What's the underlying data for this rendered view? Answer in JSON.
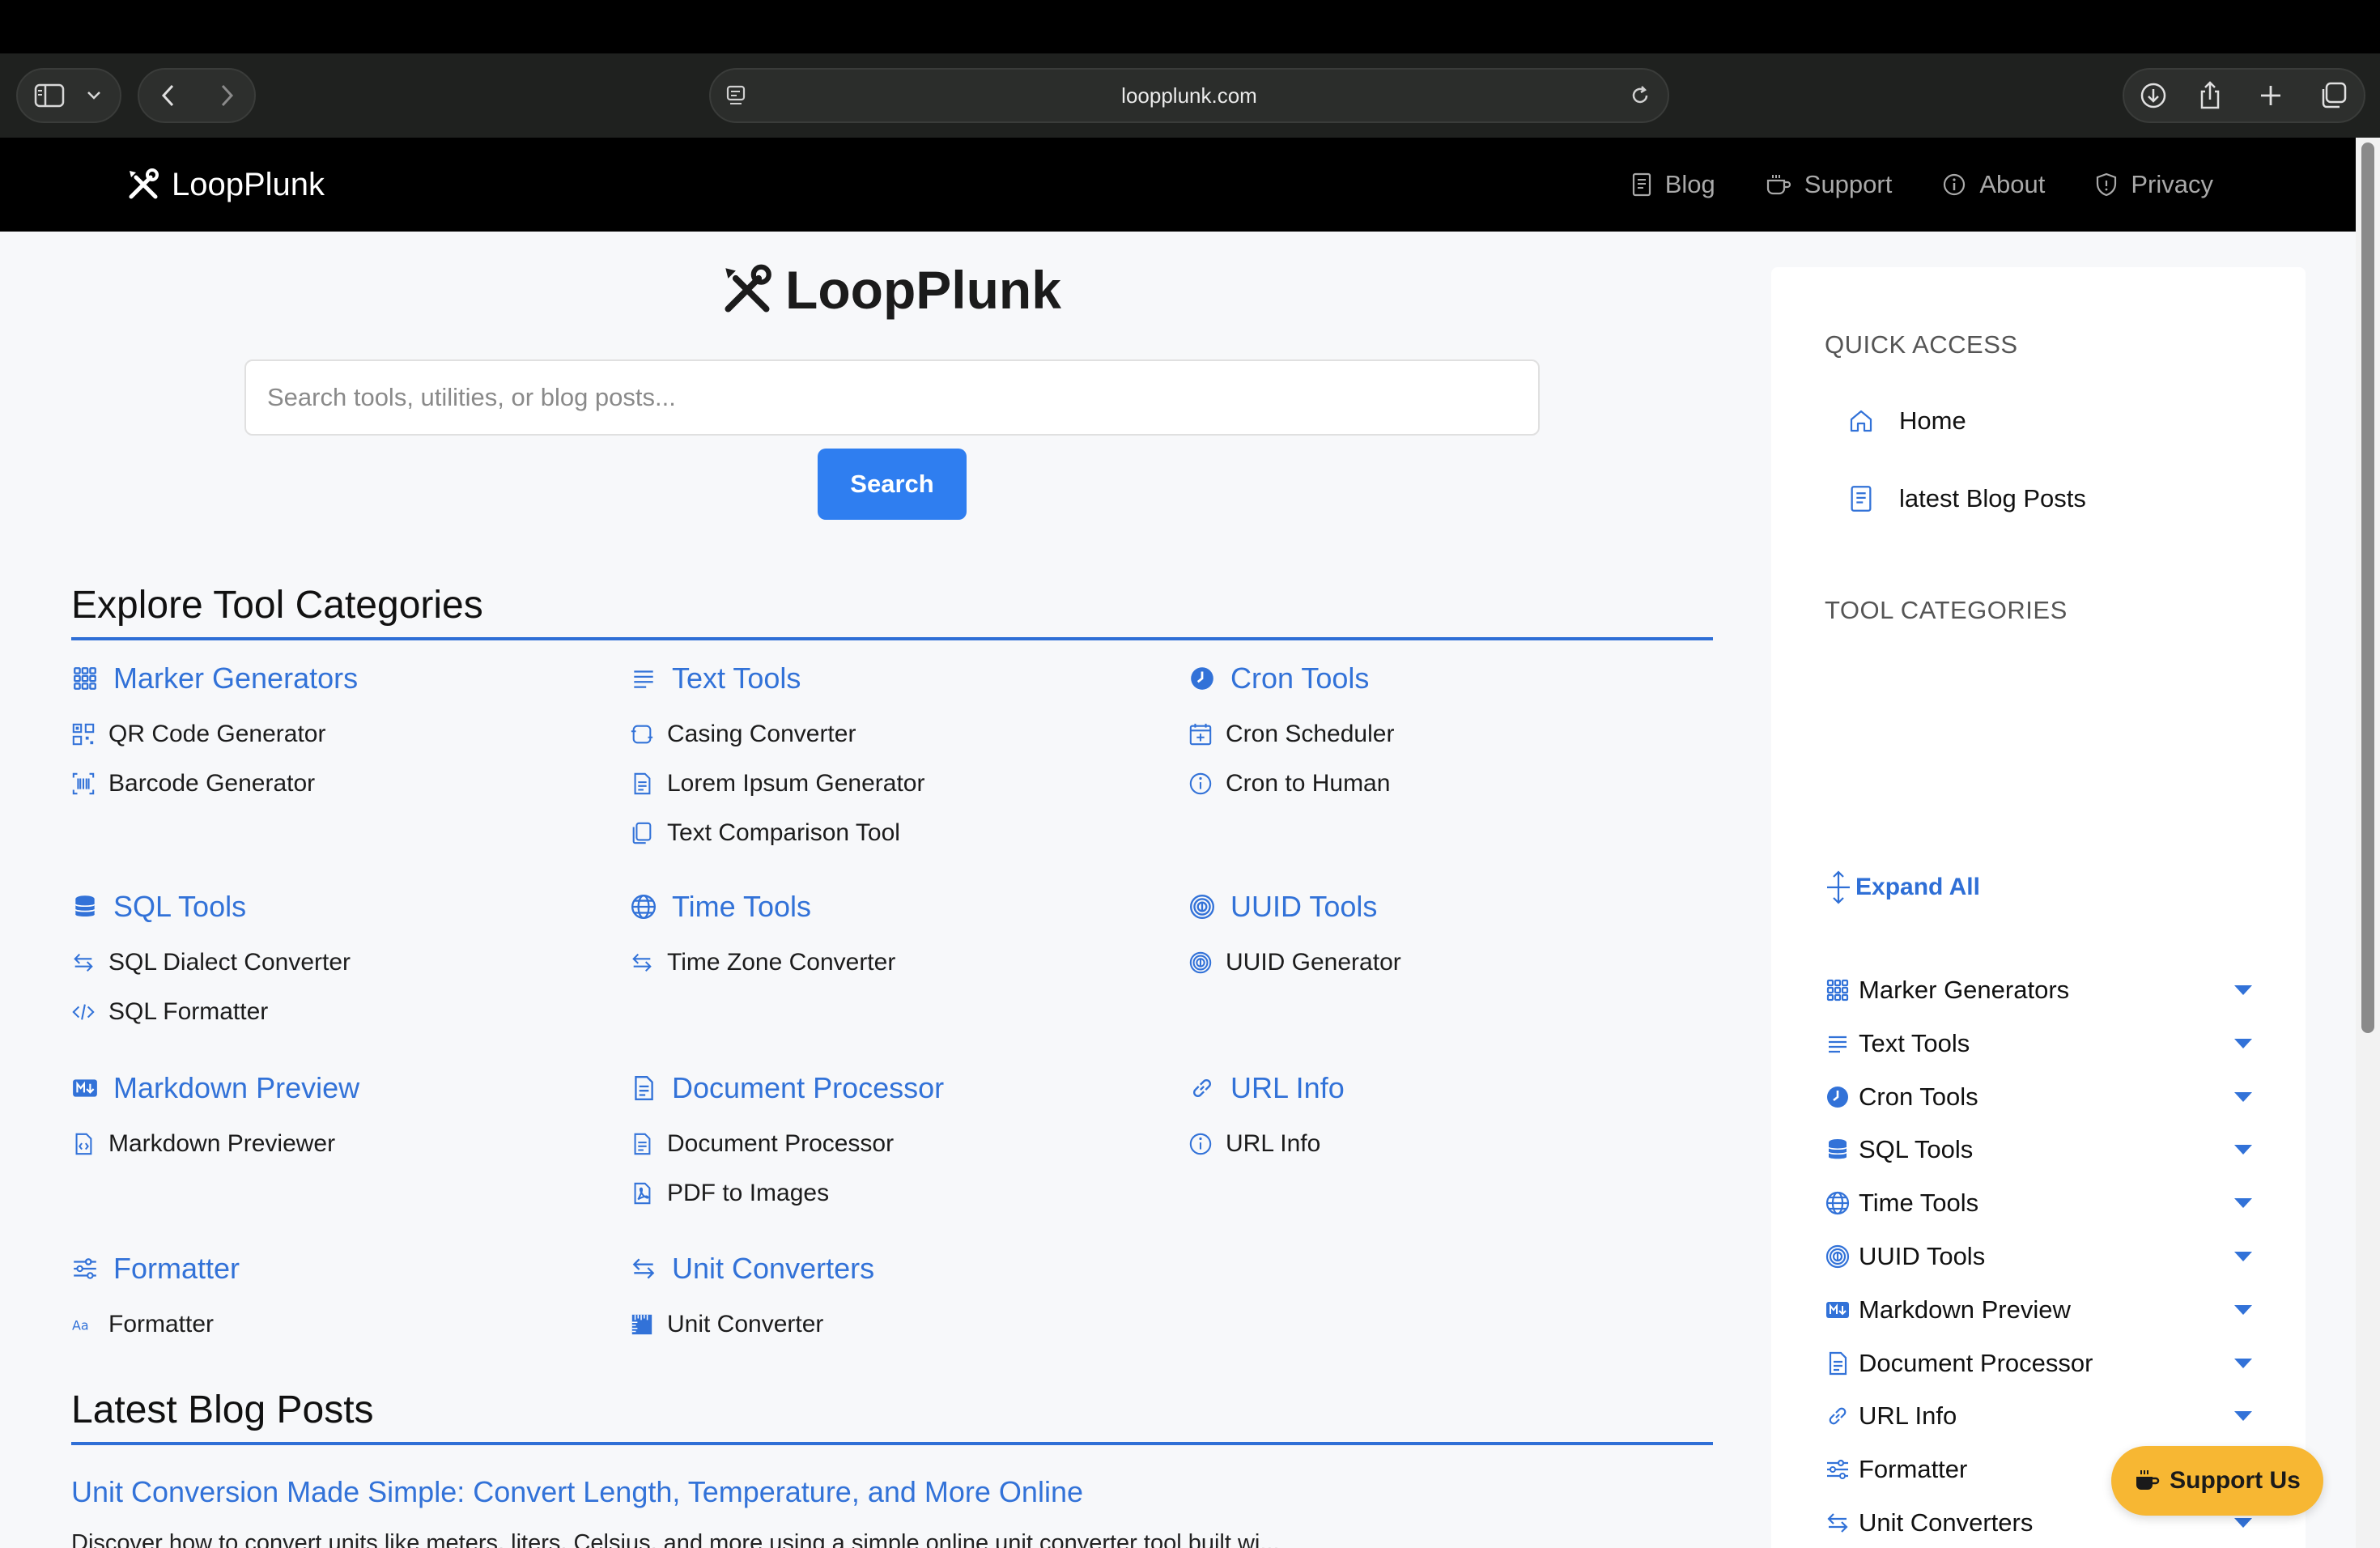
{
  "browser": {
    "url": "loopplunk.com"
  },
  "site": {
    "brand": "LoopPlunk",
    "nav": [
      {
        "label": "Blog",
        "icon": "blog-icon"
      },
      {
        "label": "Support",
        "icon": "coffee-icon"
      },
      {
        "label": "About",
        "icon": "info-icon"
      },
      {
        "label": "Privacy",
        "icon": "shield-icon"
      }
    ]
  },
  "hero": {
    "title": "LoopPlunk",
    "search_placeholder": "Search tools, utilities, or blog posts...",
    "search_button": "Search"
  },
  "explore": {
    "title": "Explore Tool Categories",
    "categories": [
      {
        "name": "Marker Generators",
        "icon": "grid-icon",
        "items": [
          {
            "label": "QR Code Generator",
            "icon": "qr-icon"
          },
          {
            "label": "Barcode Generator",
            "icon": "barcode-icon"
          }
        ]
      },
      {
        "name": "Text Tools",
        "icon": "text-lines-icon",
        "items": [
          {
            "label": "Casing Converter",
            "icon": "casing-icon"
          },
          {
            "label": "Lorem Ipsum Generator",
            "icon": "document-icon"
          },
          {
            "label": "Text Comparison Tool",
            "icon": "copy-icon"
          }
        ]
      },
      {
        "name": "Cron Tools",
        "icon": "clock-icon",
        "items": [
          {
            "label": "Cron Scheduler",
            "icon": "calendar-icon"
          },
          {
            "label": "Cron to Human",
            "icon": "info-icon"
          }
        ]
      },
      {
        "name": "SQL Tools",
        "icon": "database-icon",
        "items": [
          {
            "label": "SQL Dialect Converter",
            "icon": "arrows-icon"
          },
          {
            "label": "SQL Formatter",
            "icon": "code-icon"
          }
        ]
      },
      {
        "name": "Time Tools",
        "icon": "globe-icon",
        "items": [
          {
            "label": "Time Zone Converter",
            "icon": "arrows-icon"
          }
        ]
      },
      {
        "name": "UUID Tools",
        "icon": "fingerprint-icon",
        "items": [
          {
            "label": "UUID Generator",
            "icon": "fingerprint-icon"
          }
        ]
      },
      {
        "name": "Markdown Preview",
        "icon": "markdown-icon",
        "items": [
          {
            "label": "Markdown Previewer",
            "icon": "file-code-icon"
          }
        ]
      },
      {
        "name": "Document Processor",
        "icon": "document-icon",
        "items": [
          {
            "label": "Document Processor",
            "icon": "document-icon"
          },
          {
            "label": "PDF to Images",
            "icon": "pdf-icon"
          }
        ]
      },
      {
        "name": "URL Info",
        "icon": "link-icon",
        "items": [
          {
            "label": "URL Info",
            "icon": "info-icon"
          }
        ]
      },
      {
        "name": "Formatter",
        "icon": "sliders-icon",
        "items": [
          {
            "label": "Formatter",
            "icon": "font-icon"
          }
        ]
      },
      {
        "name": "Unit Converters",
        "icon": "arrows-icon",
        "items": [
          {
            "label": "Unit Converter",
            "icon": "ruler-icon"
          }
        ]
      }
    ]
  },
  "blog": {
    "title": "Latest Blog Posts",
    "post_title": "Unit Conversion Made Simple: Convert Length, Temperature, and More Online",
    "post_excerpt": "Discover how to convert units like meters, liters, Celsius, and more using a simple online unit converter tool built wi..."
  },
  "sidebar": {
    "quick_heading": "QUICK ACCESS",
    "quick_links": [
      {
        "label": "Home",
        "icon": "home-icon"
      },
      {
        "label": "latest Blog Posts",
        "icon": "blog-icon"
      }
    ],
    "categories_heading": "TOOL CATEGORIES",
    "expand_all": "Expand All",
    "categories": [
      {
        "label": "Marker Generators",
        "icon": "grid-icon"
      },
      {
        "label": "Text Tools",
        "icon": "text-lines-icon"
      },
      {
        "label": "Cron Tools",
        "icon": "clock-icon"
      },
      {
        "label": "SQL Tools",
        "icon": "database-icon"
      },
      {
        "label": "Time Tools",
        "icon": "globe-icon"
      },
      {
        "label": "UUID Tools",
        "icon": "fingerprint-icon"
      },
      {
        "label": "Markdown Preview",
        "icon": "markdown-icon"
      },
      {
        "label": "Document Processor",
        "icon": "document-icon"
      },
      {
        "label": "URL Info",
        "icon": "link-icon"
      },
      {
        "label": "Formatter",
        "icon": "sliders-icon"
      },
      {
        "label": "Unit Converters",
        "icon": "arrows-icon"
      }
    ]
  },
  "support_button": "Support Us",
  "colors": {
    "accent": "#3272d8",
    "button": "#2f7ef0",
    "support": "#f7b733",
    "nav_bg": "#000000",
    "page_bg": "#f7f8fa"
  }
}
